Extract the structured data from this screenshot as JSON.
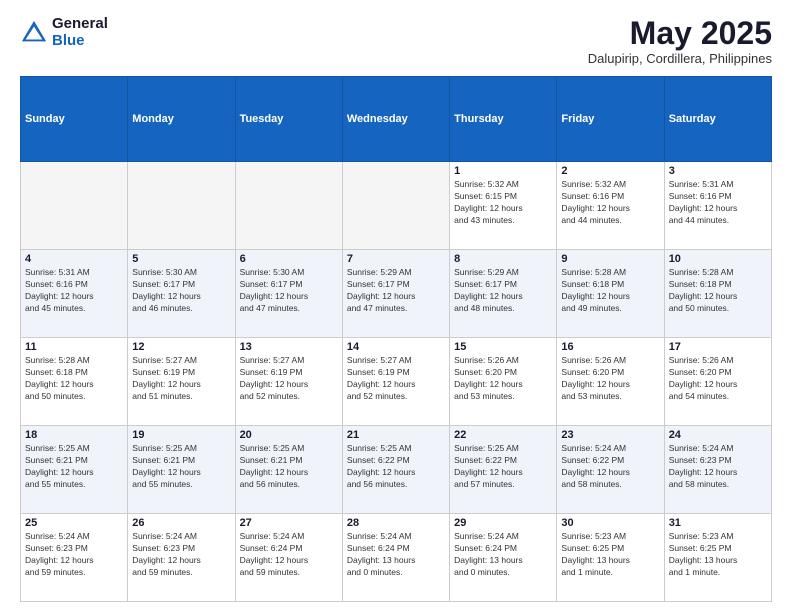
{
  "header": {
    "logo_general": "General",
    "logo_blue": "Blue",
    "month_title": "May 2025",
    "location": "Dalupirip, Cordillera, Philippines"
  },
  "days_of_week": [
    "Sunday",
    "Monday",
    "Tuesday",
    "Wednesday",
    "Thursday",
    "Friday",
    "Saturday"
  ],
  "weeks": [
    [
      {
        "day": "",
        "info": ""
      },
      {
        "day": "",
        "info": ""
      },
      {
        "day": "",
        "info": ""
      },
      {
        "day": "",
        "info": ""
      },
      {
        "day": "1",
        "info": "Sunrise: 5:32 AM\nSunset: 6:15 PM\nDaylight: 12 hours\nand 43 minutes."
      },
      {
        "day": "2",
        "info": "Sunrise: 5:32 AM\nSunset: 6:16 PM\nDaylight: 12 hours\nand 44 minutes."
      },
      {
        "day": "3",
        "info": "Sunrise: 5:31 AM\nSunset: 6:16 PM\nDaylight: 12 hours\nand 44 minutes."
      }
    ],
    [
      {
        "day": "4",
        "info": "Sunrise: 5:31 AM\nSunset: 6:16 PM\nDaylight: 12 hours\nand 45 minutes."
      },
      {
        "day": "5",
        "info": "Sunrise: 5:30 AM\nSunset: 6:17 PM\nDaylight: 12 hours\nand 46 minutes."
      },
      {
        "day": "6",
        "info": "Sunrise: 5:30 AM\nSunset: 6:17 PM\nDaylight: 12 hours\nand 47 minutes."
      },
      {
        "day": "7",
        "info": "Sunrise: 5:29 AM\nSunset: 6:17 PM\nDaylight: 12 hours\nand 47 minutes."
      },
      {
        "day": "8",
        "info": "Sunrise: 5:29 AM\nSunset: 6:17 PM\nDaylight: 12 hours\nand 48 minutes."
      },
      {
        "day": "9",
        "info": "Sunrise: 5:28 AM\nSunset: 6:18 PM\nDaylight: 12 hours\nand 49 minutes."
      },
      {
        "day": "10",
        "info": "Sunrise: 5:28 AM\nSunset: 6:18 PM\nDaylight: 12 hours\nand 50 minutes."
      }
    ],
    [
      {
        "day": "11",
        "info": "Sunrise: 5:28 AM\nSunset: 6:18 PM\nDaylight: 12 hours\nand 50 minutes."
      },
      {
        "day": "12",
        "info": "Sunrise: 5:27 AM\nSunset: 6:19 PM\nDaylight: 12 hours\nand 51 minutes."
      },
      {
        "day": "13",
        "info": "Sunrise: 5:27 AM\nSunset: 6:19 PM\nDaylight: 12 hours\nand 52 minutes."
      },
      {
        "day": "14",
        "info": "Sunrise: 5:27 AM\nSunset: 6:19 PM\nDaylight: 12 hours\nand 52 minutes."
      },
      {
        "day": "15",
        "info": "Sunrise: 5:26 AM\nSunset: 6:20 PM\nDaylight: 12 hours\nand 53 minutes."
      },
      {
        "day": "16",
        "info": "Sunrise: 5:26 AM\nSunset: 6:20 PM\nDaylight: 12 hours\nand 53 minutes."
      },
      {
        "day": "17",
        "info": "Sunrise: 5:26 AM\nSunset: 6:20 PM\nDaylight: 12 hours\nand 54 minutes."
      }
    ],
    [
      {
        "day": "18",
        "info": "Sunrise: 5:25 AM\nSunset: 6:21 PM\nDaylight: 12 hours\nand 55 minutes."
      },
      {
        "day": "19",
        "info": "Sunrise: 5:25 AM\nSunset: 6:21 PM\nDaylight: 12 hours\nand 55 minutes."
      },
      {
        "day": "20",
        "info": "Sunrise: 5:25 AM\nSunset: 6:21 PM\nDaylight: 12 hours\nand 56 minutes."
      },
      {
        "day": "21",
        "info": "Sunrise: 5:25 AM\nSunset: 6:22 PM\nDaylight: 12 hours\nand 56 minutes."
      },
      {
        "day": "22",
        "info": "Sunrise: 5:25 AM\nSunset: 6:22 PM\nDaylight: 12 hours\nand 57 minutes."
      },
      {
        "day": "23",
        "info": "Sunrise: 5:24 AM\nSunset: 6:22 PM\nDaylight: 12 hours\nand 58 minutes."
      },
      {
        "day": "24",
        "info": "Sunrise: 5:24 AM\nSunset: 6:23 PM\nDaylight: 12 hours\nand 58 minutes."
      }
    ],
    [
      {
        "day": "25",
        "info": "Sunrise: 5:24 AM\nSunset: 6:23 PM\nDaylight: 12 hours\nand 59 minutes."
      },
      {
        "day": "26",
        "info": "Sunrise: 5:24 AM\nSunset: 6:23 PM\nDaylight: 12 hours\nand 59 minutes."
      },
      {
        "day": "27",
        "info": "Sunrise: 5:24 AM\nSunset: 6:24 PM\nDaylight: 12 hours\nand 59 minutes."
      },
      {
        "day": "28",
        "info": "Sunrise: 5:24 AM\nSunset: 6:24 PM\nDaylight: 13 hours\nand 0 minutes."
      },
      {
        "day": "29",
        "info": "Sunrise: 5:24 AM\nSunset: 6:24 PM\nDaylight: 13 hours\nand 0 minutes."
      },
      {
        "day": "30",
        "info": "Sunrise: 5:23 AM\nSunset: 6:25 PM\nDaylight: 13 hours\nand 1 minute."
      },
      {
        "day": "31",
        "info": "Sunrise: 5:23 AM\nSunset: 6:25 PM\nDaylight: 13 hours\nand 1 minute."
      }
    ]
  ]
}
